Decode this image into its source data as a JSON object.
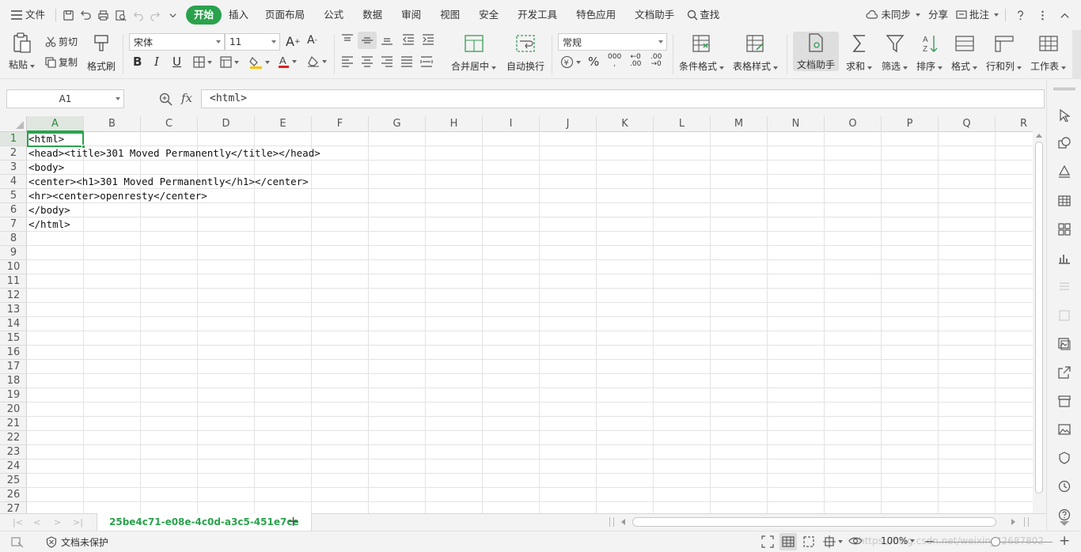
{
  "menubar": {
    "file_label": "文件",
    "tabs": [
      "开始",
      "插入",
      "页面布局",
      "公式",
      "数据",
      "审阅",
      "视图",
      "安全",
      "开发工具",
      "特色应用",
      "文档助手"
    ],
    "search_label": "查找",
    "sync_label": "未同步",
    "share_label": "分享",
    "comment_label": "批注"
  },
  "ribbon": {
    "paste": "粘贴",
    "cut": "剪切",
    "copy": "复制",
    "format_painter": "格式刷",
    "font_name": "宋体",
    "font_size": "11",
    "merge_center": "合并居中",
    "wrap_text": "自动换行",
    "number_format": "常规",
    "conditional_format": "条件格式",
    "table_style": "表格样式",
    "doc_assistant": "文档助手",
    "sum": "求和",
    "filter": "筛选",
    "sort": "排序",
    "format": "格式",
    "row_col": "行和列",
    "worksheet": "工作表"
  },
  "formula": {
    "cell_ref": "A1",
    "fx": "fx",
    "content": "<html>"
  },
  "columns": [
    "A",
    "B",
    "C",
    "D",
    "E",
    "F",
    "G",
    "H",
    "I",
    "J",
    "K",
    "L",
    "M",
    "N",
    "O",
    "P",
    "Q",
    "R"
  ],
  "rows": [
    "1",
    "2",
    "3",
    "4",
    "5",
    "6",
    "7",
    "8",
    "9",
    "10",
    "11",
    "12",
    "13",
    "14",
    "15",
    "16",
    "17",
    "18",
    "19",
    "20",
    "21",
    "22",
    "23",
    "24",
    "25",
    "26",
    "27"
  ],
  "cells": [
    "<html>",
    "<head><title>301 Moved Permanently</title></head>",
    "<body>",
    "<center><h1>301 Moved Permanently</h1></center>",
    "<hr><center>openresty</center>",
    "</body>",
    "</html>"
  ],
  "sheet": {
    "tab_name": "25be4c71-e08e-4c0d-a3c5-451e7ce",
    "add_label": "+"
  },
  "status": {
    "protect_label": "文档未保护",
    "zoom": "100%",
    "watermark": "https://blog.csdn.net/weixin_42687802"
  },
  "colors": {
    "accent": "#2aa24d"
  }
}
